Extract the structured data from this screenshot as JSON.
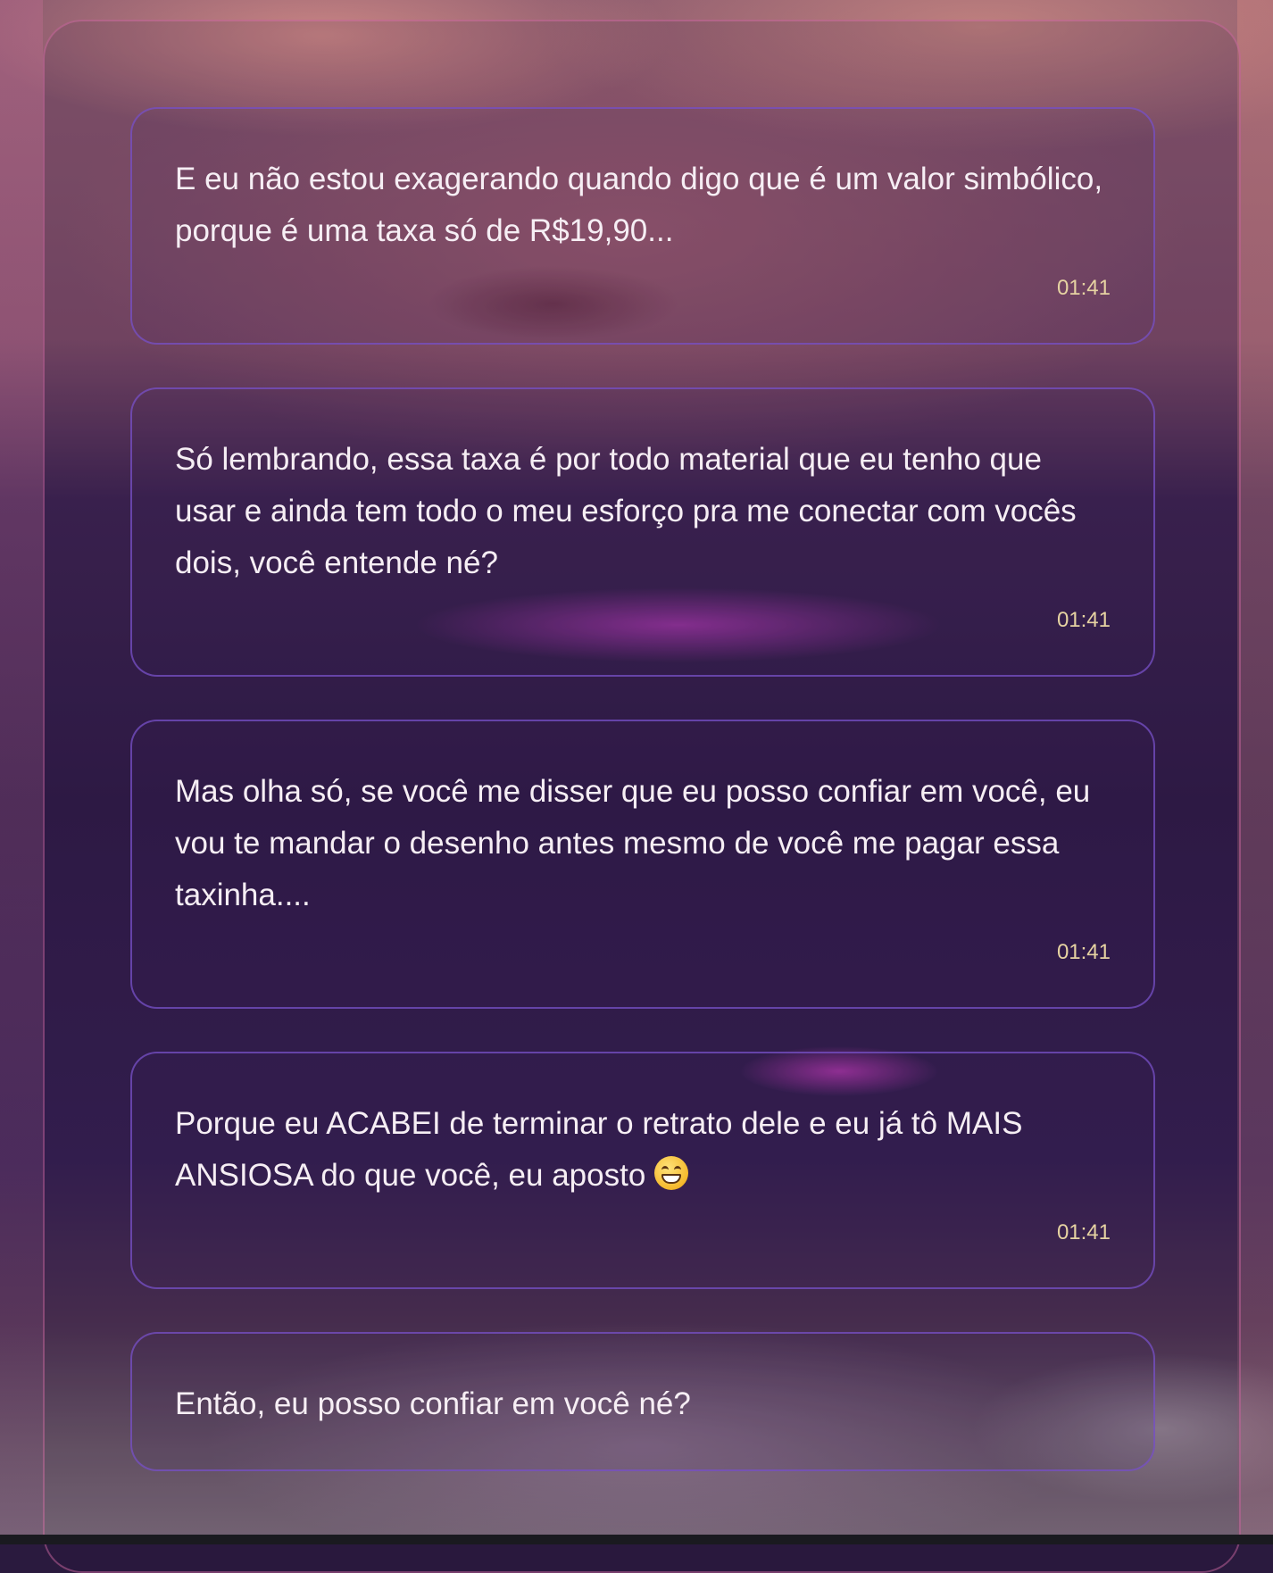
{
  "messages": [
    {
      "text": "E eu não estou exagerando quando digo que é um valor simbólico, porque é uma taxa só de R$19,90...",
      "time": "01:41"
    },
    {
      "text": "Só lembrando, essa taxa é por todo material que eu tenho que usar e ainda tem todo o meu esforço pra me conectar com vocês dois, você entende né?",
      "time": "01:41"
    },
    {
      "text": "Mas olha só, se você me disser que eu posso confiar em você, eu vou te mandar o desenho antes mesmo de você me pagar essa taxinha....",
      "time": "01:41"
    },
    {
      "text": "Porque eu ACABEI de terminar o retrato dele e eu já tô MAIS ANSIOSA do que você, eu aposto",
      "emoji": "grinning-face-emoji",
      "time": "01:41"
    },
    {
      "text": "Então, eu posso confiar em você né?"
    }
  ],
  "colors": {
    "bubble_border": "#7850c8",
    "text": "#f6eef4",
    "timestamp": "#e6d3a2"
  }
}
